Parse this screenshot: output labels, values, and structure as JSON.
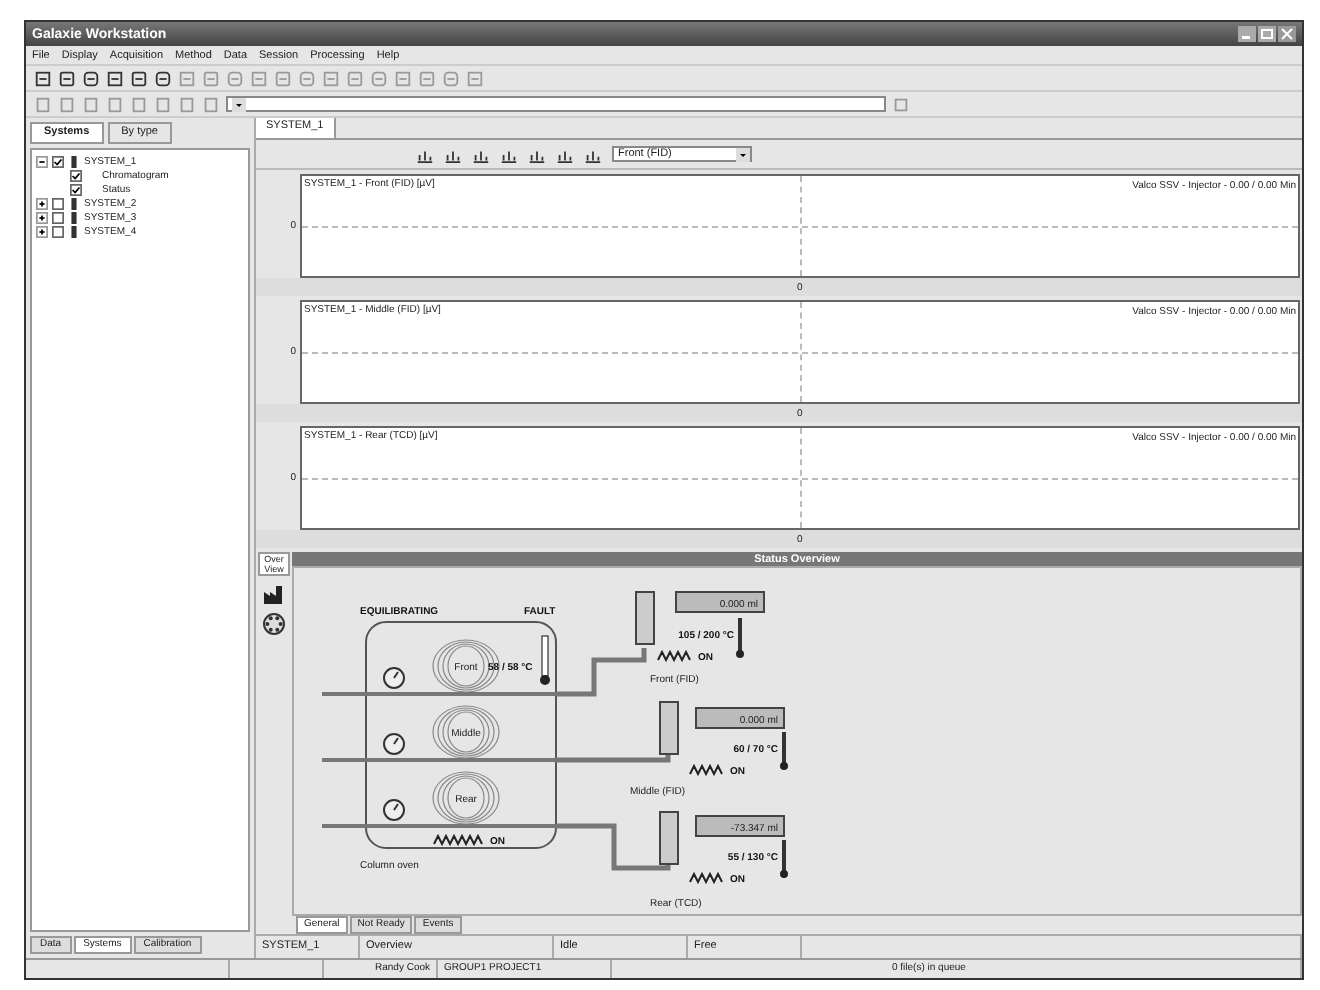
{
  "window": {
    "title": "Galaxie Workstation"
  },
  "menu": [
    "File",
    "Display",
    "Acquisition",
    "Method",
    "Data",
    "Session",
    "Processing",
    "Help"
  ],
  "left_panel": {
    "tabs": [
      {
        "label": "Systems",
        "selected": true
      },
      {
        "label": "By type",
        "selected": false
      }
    ],
    "tree": [
      {
        "label": "SYSTEM_1",
        "checked": true,
        "expanded": true,
        "children": [
          {
            "label": "Chromatogram",
            "checked": true
          },
          {
            "label": "Status",
            "checked": true
          }
        ]
      },
      {
        "label": "SYSTEM_2",
        "checked": false,
        "expanded": false
      },
      {
        "label": "SYSTEM_3",
        "checked": false,
        "expanded": false
      },
      {
        "label": "SYSTEM_4",
        "checked": false,
        "expanded": false
      }
    ],
    "bottom_tabs": [
      {
        "label": "Data",
        "selected": false
      },
      {
        "label": "Systems",
        "selected": true
      },
      {
        "label": "Calibration",
        "selected": false
      }
    ]
  },
  "document_tab": {
    "label": "SYSTEM_1"
  },
  "detector_select": {
    "value": "Front (FID)"
  },
  "charts": [
    {
      "title": "SYSTEM_1 - Front (FID) [µV]",
      "y_tick": "0",
      "x_tick": "0",
      "info": "Valco SSV - Injector - 0.00 / 0.00 Min"
    },
    {
      "title": "SYSTEM_1 - Middle (FID) [µV]",
      "y_tick": "0",
      "x_tick": "0",
      "info": "Valco SSV - Injector - 0.00 / 0.00 Min"
    },
    {
      "title": "SYSTEM_1 - Rear (TCD) [µV]",
      "y_tick": "0",
      "x_tick": "0",
      "info": "Valco SSV - Injector - 0.00 / 0.00 Min"
    }
  ],
  "status_overview": {
    "side_tab": "Over View",
    "header": "Status Overview",
    "state": "EQUILIBRATING",
    "fault": "FAULT",
    "oven": {
      "label": "Column oven",
      "temperature": "58 / 58 °C",
      "heater": "ON"
    },
    "channels": [
      {
        "coil": "Front",
        "detector": "Front (FID)",
        "volume": "0.000 ml",
        "temperature": "105 / 200 °C",
        "heater": "ON"
      },
      {
        "coil": "Middle",
        "detector": "Middle (FID)",
        "volume": "0.000 ml",
        "temperature": "60 / 70 °C",
        "heater": "ON"
      },
      {
        "coil": "Rear",
        "detector": "Rear (TCD)",
        "volume": "-73.347 ml",
        "temperature": "55 / 130 °C",
        "heater": "ON"
      }
    ],
    "tabs": [
      {
        "label": "General",
        "selected": true
      },
      {
        "label": "Not Ready",
        "selected": false
      },
      {
        "label": "Events",
        "selected": false
      }
    ]
  },
  "status_row": [
    "SYSTEM_1",
    "Overview",
    "Idle",
    "Free"
  ],
  "status_bar": [
    "Randy Cook",
    "GROUP1 PROJECT1",
    "0 file(s) in queue"
  ]
}
